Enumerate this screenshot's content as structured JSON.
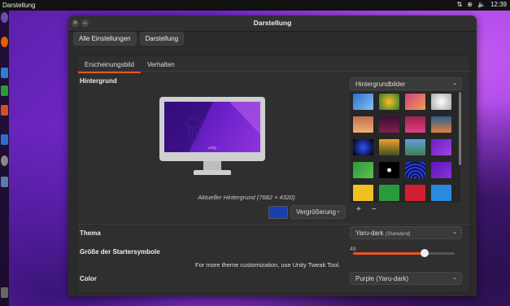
{
  "topbar": {
    "app": "Darstellung",
    "time": "12:39"
  },
  "window": {
    "title": "Darstellung",
    "breadcrumbs": [
      "Alle Einstellungen",
      "Darstellung"
    ],
    "tabs": [
      "Erscheinungsbild",
      "Verhalten"
    ],
    "background": {
      "label": "Hintergrund",
      "monitor_brand": "unity",
      "caption": "Aktueller Hintergrund (7682 × 4320)",
      "source": "Hintergrundbilder",
      "mode": "Vergrößerung",
      "add": "+",
      "remove": "−",
      "swatch_color": "#1a3fb0"
    },
    "theme": {
      "label": "Thema",
      "value": "Yaru-dark",
      "value_suffix": "(Standard)"
    },
    "launcher": {
      "label": "Größe der Startersymbole",
      "value": "48",
      "fraction": 0.7
    },
    "tweak_note": "For more theme customization, use Unity Tweak Tool.",
    "color": {
      "label": "Color",
      "value": "Purple (Yaru-dark)"
    }
  },
  "accent": "#e95420"
}
